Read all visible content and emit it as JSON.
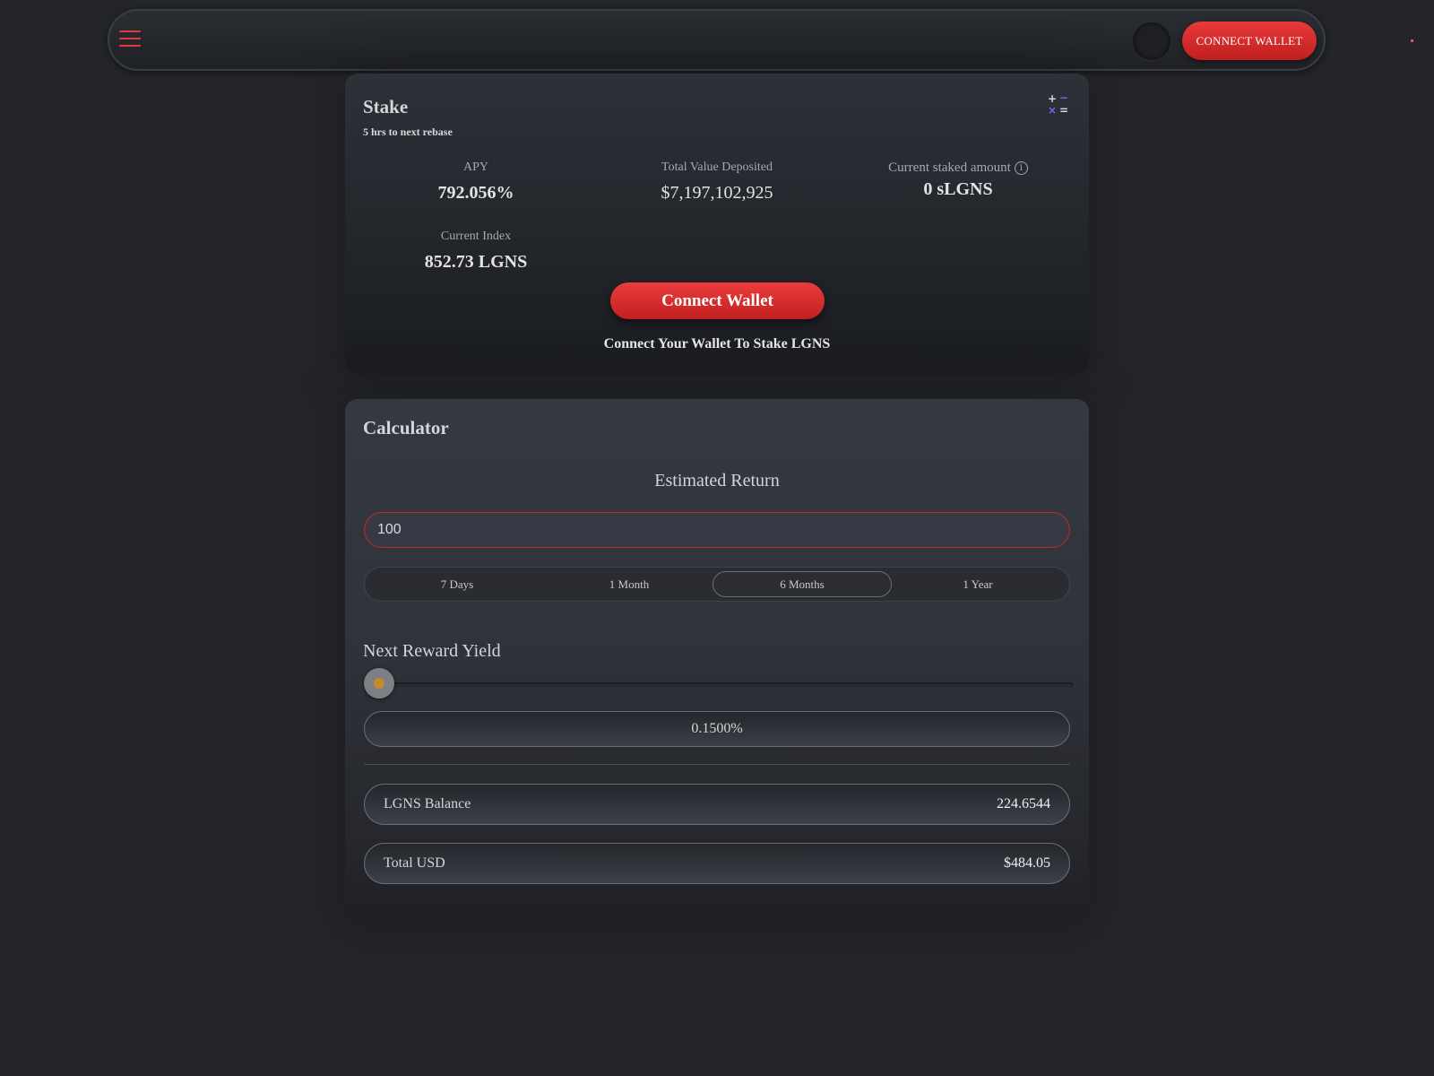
{
  "header": {
    "connect_label": "CONNECT WALLET"
  },
  "stake": {
    "title": "Stake",
    "rebase_note": "5 hrs to next rebase",
    "apy": {
      "label": "APY",
      "value": "792.056%"
    },
    "tvd": {
      "label": "Total Value Deposited",
      "value": "$7,197,102,925"
    },
    "staked": {
      "label": "Current staked amount",
      "value": "0 sLGNS"
    },
    "index": {
      "label": "Current Index",
      "value": "852.73 LGNS"
    },
    "connect_label": "Connect Wallet",
    "connect_note": "Connect Your Wallet To Stake LGNS"
  },
  "calculator": {
    "title": "Calculator",
    "estimated_return_label": "Estimated Return",
    "amount_value": "100",
    "periods": [
      "7 Days",
      "1 Month",
      "6 Months",
      "1 Year"
    ],
    "selected_period": "6 Months",
    "reward_yield_label": "Next Reward Yield",
    "reward_yield_slider_fraction": 0.02,
    "reward_yield_value": "0.1500%",
    "balance": {
      "label": "LGNS Balance",
      "value": "224.6544"
    },
    "total_usd": {
      "label": "Total USD",
      "value": "$484.05"
    }
  },
  "icons": {
    "menu": "hamburger-menu-icon",
    "theme": "theme-toggle-icon",
    "calculator": "calculator-icon",
    "info": "info-icon"
  },
  "colors": {
    "accent_red": "#e03a3a",
    "calc_icon_purple": "#7b5cf0",
    "calc_icon_light": "#d8d9dc",
    "slider_thumb_inner": "#c48a2b"
  }
}
